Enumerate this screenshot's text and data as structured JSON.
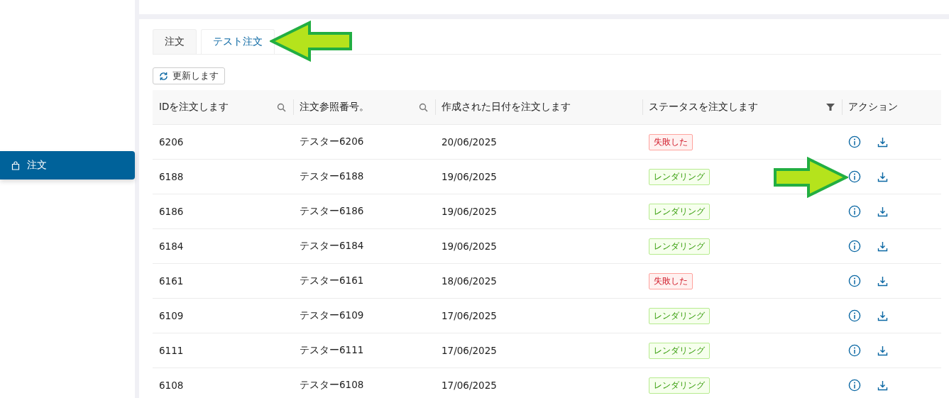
{
  "sidebar": {
    "items": [
      {
        "label": "注文",
        "selected": true
      }
    ]
  },
  "tabs": [
    {
      "label": "注文",
      "selected": false
    },
    {
      "label": "テスト注文",
      "selected": true
    }
  ],
  "refresh_button": "更新します",
  "table": {
    "columns": [
      {
        "label": "IDを注文します",
        "kind": "search"
      },
      {
        "label": "注文参照番号。",
        "kind": "search"
      },
      {
        "label": "作成された日付を注文します",
        "kind": "plain"
      },
      {
        "label": "ステータスを注文します",
        "kind": "filter"
      },
      {
        "label": "アクション",
        "kind": "plain"
      }
    ],
    "rows": [
      {
        "id": "6206",
        "ref": "テスター6206",
        "date": "20/06/2025",
        "status": {
          "label": "失敗した",
          "kind": "failed"
        }
      },
      {
        "id": "6188",
        "ref": "テスター6188",
        "date": "19/06/2025",
        "status": {
          "label": "レンダリング",
          "kind": "rendering"
        }
      },
      {
        "id": "6186",
        "ref": "テスター6186",
        "date": "19/06/2025",
        "status": {
          "label": "レンダリング",
          "kind": "rendering"
        }
      },
      {
        "id": "6184",
        "ref": "テスター6184",
        "date": "19/06/2025",
        "status": {
          "label": "レンダリング",
          "kind": "rendering"
        }
      },
      {
        "id": "6161",
        "ref": "テスター6161",
        "date": "18/06/2025",
        "status": {
          "label": "失敗した",
          "kind": "failed"
        }
      },
      {
        "id": "6109",
        "ref": "テスター6109",
        "date": "17/06/2025",
        "status": {
          "label": "レンダリング",
          "kind": "rendering"
        }
      },
      {
        "id": "6111",
        "ref": "テスター6111",
        "date": "17/06/2025",
        "status": {
          "label": "レンダリング",
          "kind": "rendering"
        }
      },
      {
        "id": "6108",
        "ref": "テスター6108",
        "date": "17/06/2025",
        "status": {
          "label": "レンダリング",
          "kind": "rendering"
        }
      }
    ]
  }
}
